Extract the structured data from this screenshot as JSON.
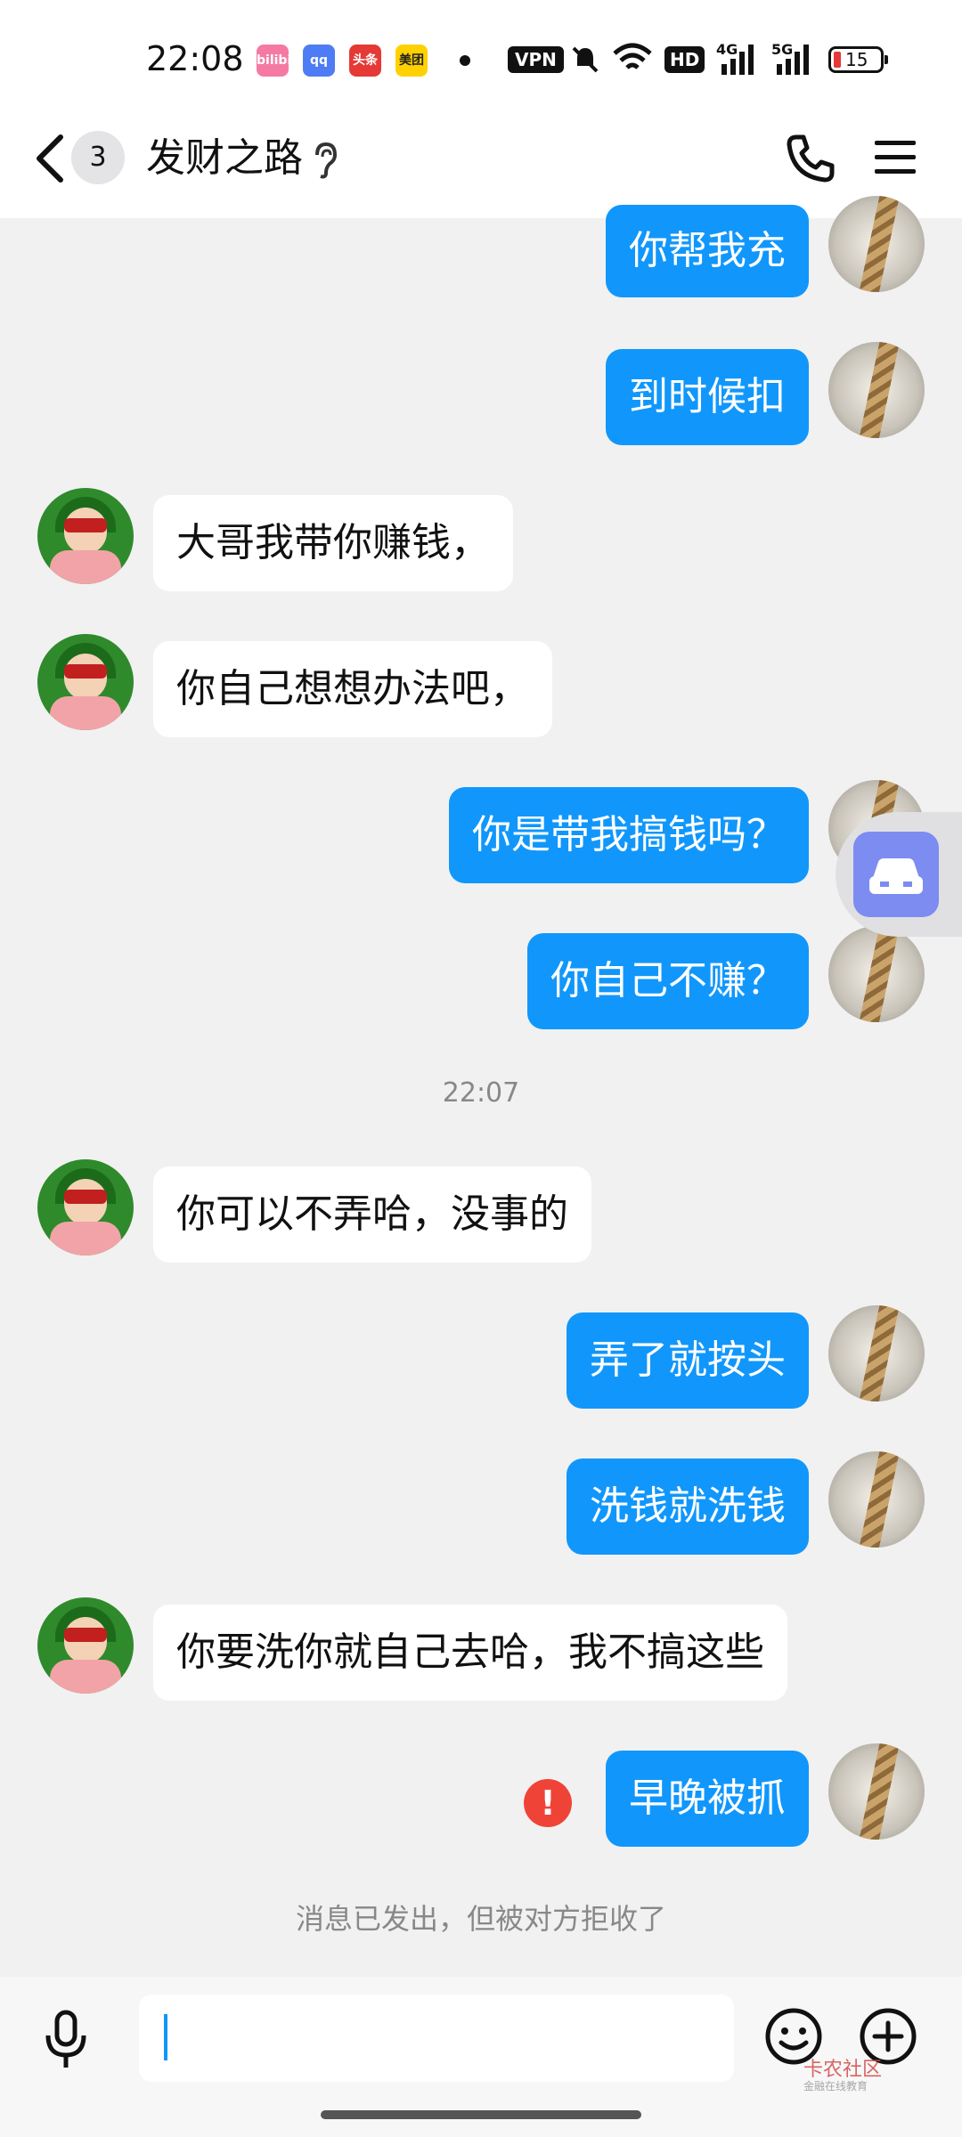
{
  "status_bar": {
    "time": "22:08",
    "app_icons": [
      "bilibili",
      "qq",
      "头条",
      "美团"
    ],
    "vpn_label": "VPN",
    "hd_label": "HD",
    "signal_labels": [
      "4G",
      "5G"
    ],
    "battery": "15"
  },
  "header": {
    "unread_count": "3",
    "title": "发财之路"
  },
  "messages": [
    {
      "side": "out",
      "text": "你帮我充"
    },
    {
      "side": "out",
      "text": "到时候扣"
    },
    {
      "side": "in",
      "text": "大哥我带你赚钱，"
    },
    {
      "side": "in",
      "text": "你自己想想办法吧，"
    },
    {
      "side": "out",
      "text": "你是带我搞钱吗？"
    },
    {
      "side": "out",
      "text": "你自己不赚？"
    },
    {
      "side": "in",
      "text": "你可以不弄哈，没事的"
    },
    {
      "side": "out",
      "text": "弄了就按头"
    },
    {
      "side": "out",
      "text": "洗钱就洗钱"
    },
    {
      "side": "in",
      "text": "你要洗你就自己去哈，我不搞这些"
    },
    {
      "side": "out",
      "text": "早晚被抓"
    }
  ],
  "timestamp": "22:07",
  "rejection_notice": "消息已发出，但被对方拒收了",
  "error_mark": "!",
  "input": {
    "placeholder": ""
  },
  "watermark": {
    "title": "卡农社区",
    "subtitle": "金融在线教育"
  },
  "colors": {
    "out_bubble": "#1197fb",
    "in_bubble": "#ffffff",
    "error": "#f04337"
  }
}
